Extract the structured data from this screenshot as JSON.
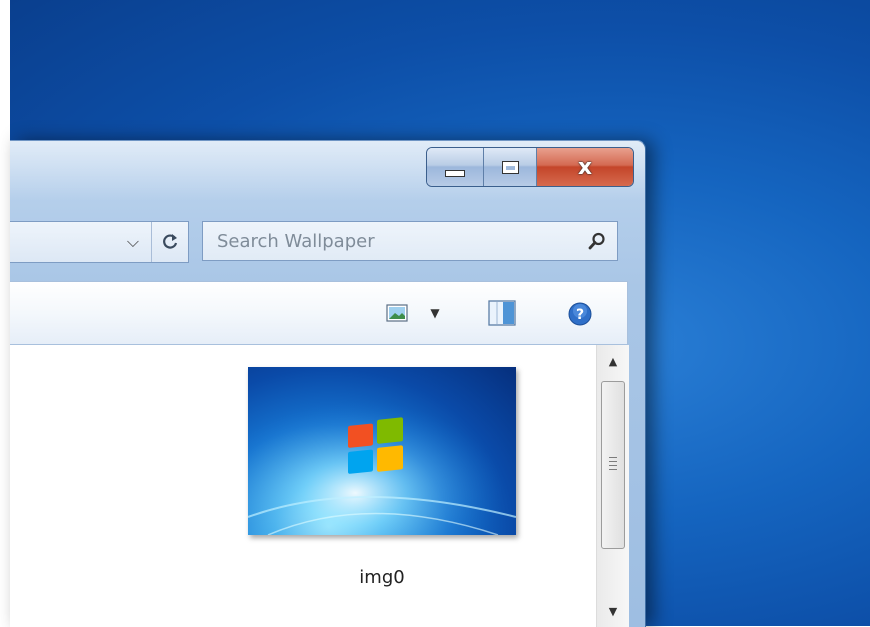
{
  "window": {
    "close_label": "x"
  },
  "address": {
    "dropdown_icon": "chevron-down-icon",
    "refresh_icon": "refresh-icon"
  },
  "search": {
    "placeholder": "Search Wallpaper",
    "value": ""
  },
  "toolbar": {
    "view_icon": "change-view-icon",
    "preview_icon": "preview-pane-icon",
    "help_icon": "help-icon"
  },
  "files": [
    {
      "name": "img0"
    }
  ],
  "colors": {
    "desktop": "#1565c0",
    "close_button": "#c4452a",
    "window_frame": "#a9c6e6"
  }
}
